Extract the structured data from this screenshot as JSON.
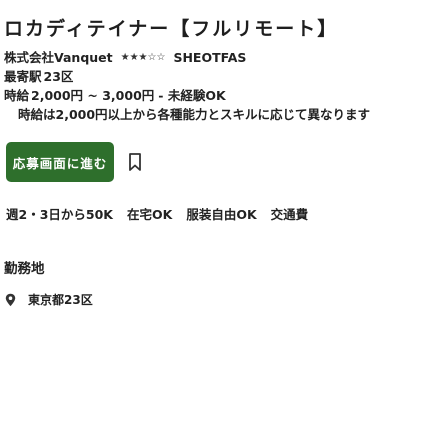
{
  "job": {
    "title": "ロカディテイナー【フルリモート】",
    "company_name": "株式会社Vanquet",
    "company_rating_text": "★★★☆☆",
    "company_rating": 3,
    "company_type": "SHEOTFAS",
    "station_label": "最寄駅",
    "station": "23区",
    "salary_label": "時給",
    "salary": "2,000円 ~ 3,000円",
    "salary_suffix": "- 未経験OK",
    "salary_note": "時給は2,000円以上から各種能力とスキルに応じて異なります"
  },
  "actions": {
    "contact_label": "応募画面に進む"
  },
  "tags": [
    "週2・3日から50K",
    "在宅OK",
    "服装自由OK",
    "交通費"
  ],
  "workplace": {
    "section_title": "勤務地",
    "location": "東京都23区"
  },
  "colors": {
    "accent": "#2e6f2c",
    "text": "#222222",
    "background": "#ffffff"
  },
  "icons": {
    "bookmark": "bookmark-icon",
    "location": "location-pin-icon"
  }
}
